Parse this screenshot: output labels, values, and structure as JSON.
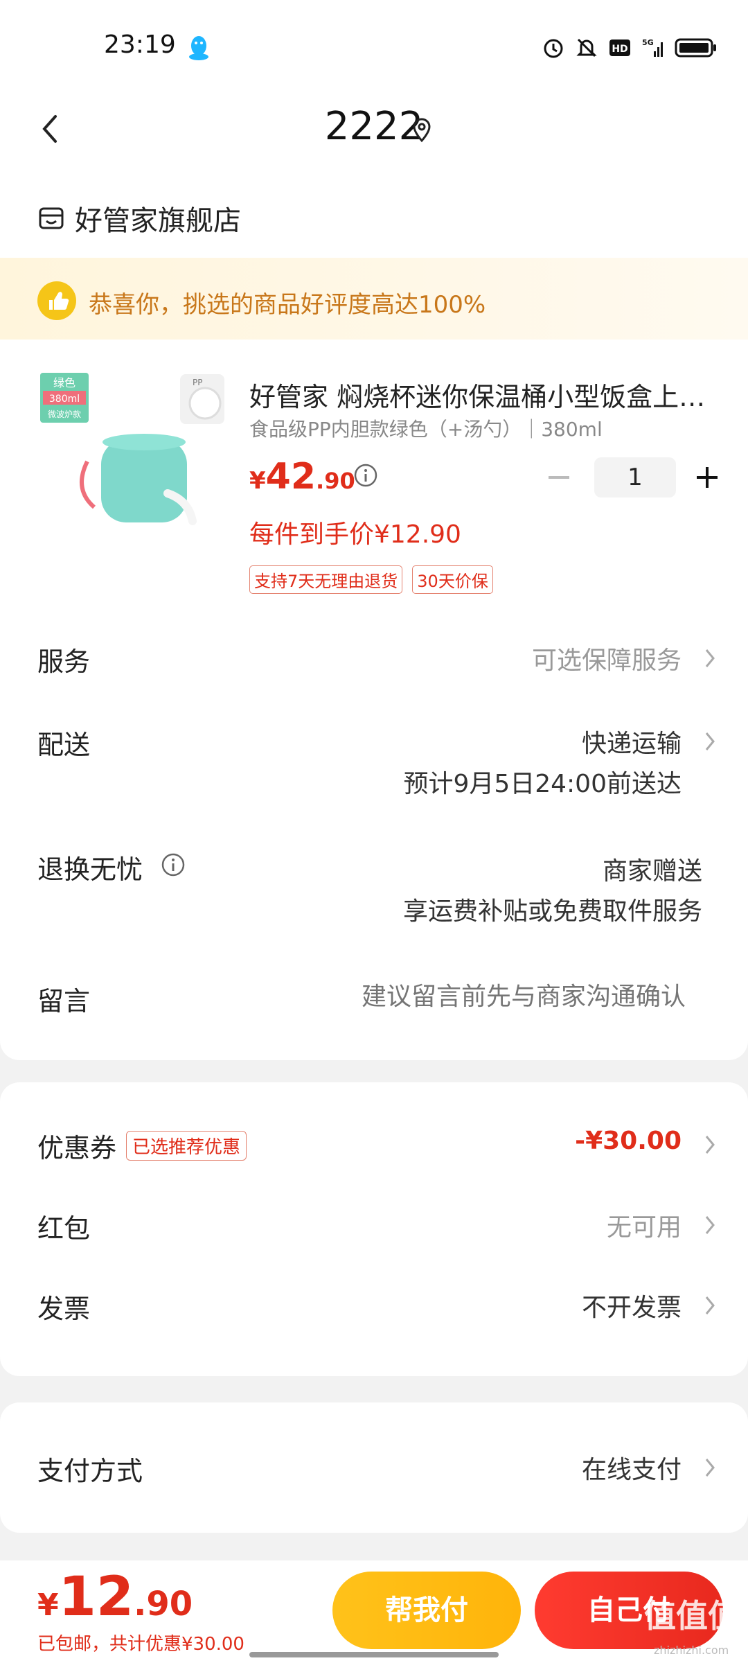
{
  "status_bar": {
    "time": "23:19"
  },
  "header": {
    "title": "2222"
  },
  "shop": {
    "name": "好管家旗舰店"
  },
  "banner": {
    "text": "恭喜你，挑选的商品好评度高达100%"
  },
  "product": {
    "image_badge": {
      "color": "绿色",
      "size": "380ml",
      "note": "微波炉款",
      "pp": "PP"
    },
    "title": "好管家 焖烧杯迷你保温桶小型饭盒上…",
    "spec": "食品级PP内胆款绿色（+汤勺）｜380ml",
    "price_currency": "¥",
    "price_int": "42",
    "price_dec": ".90",
    "quantity": "1",
    "hand_price": "每件到手价¥12.90",
    "tags": [
      "支持7天无理由退货",
      "30天价保"
    ]
  },
  "rows": {
    "service": {
      "label": "服务",
      "value": "可选保障服务"
    },
    "delivery": {
      "label": "配送",
      "value": "快递运输",
      "eta": "预计9月5日24:00前送达"
    },
    "returns": {
      "label": "退换无忧",
      "value": "商家赠送",
      "sub": "享运费补贴或免费取件服务"
    },
    "message": {
      "label": "留言",
      "placeholder": "建议留言前先与商家沟通确认"
    }
  },
  "discounts": {
    "coupon": {
      "label": "优惠券",
      "badge": "已选推荐优惠",
      "value": "-¥30.00"
    },
    "redpacket": {
      "label": "红包",
      "value": "无可用"
    },
    "invoice": {
      "label": "发票",
      "value": "不开发票"
    }
  },
  "payment": {
    "label": "支付方式",
    "value": "在线支付"
  },
  "bottom_bar": {
    "currency": "¥",
    "total_int": "12",
    "total_dec": ".90",
    "note": "已包邮，共计优惠¥30.00",
    "help_pay_label": "帮我付",
    "self_pay_label": "自己付"
  },
  "watermark": {
    "logo": "值值值",
    "site": "zhizhizhi.com"
  },
  "colors": {
    "accent": "#e02d1a",
    "gold": "#ffc21a",
    "banner_text": "#c8771a"
  }
}
